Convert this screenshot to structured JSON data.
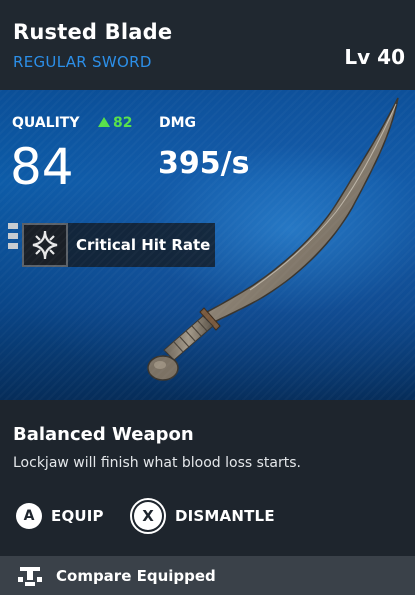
{
  "item": {
    "name": "Rusted Blade",
    "type": "REGULAR SWORD",
    "level": "Lv 40"
  },
  "stats": {
    "quality_label": "QUALITY",
    "quality_delta": "82",
    "quality_value": "84",
    "dmg_label": "DMG",
    "dmg_value": "395/s"
  },
  "perk": {
    "label": "Critical Hit Rate",
    "icon": "critical-hit-icon"
  },
  "description": {
    "title": "Balanced Weapon",
    "text": "Lockjaw will finish what blood loss starts."
  },
  "actions": {
    "equip_key": "A",
    "equip_label": "EQUIP",
    "dismantle_key": "X",
    "dismantle_label": "DISMANTLE"
  },
  "footer": {
    "label": "Compare Equipped",
    "icon": "compare-icon"
  },
  "colors": {
    "accent_blue": "#2c8fe8",
    "positive_green": "#57e04a"
  }
}
